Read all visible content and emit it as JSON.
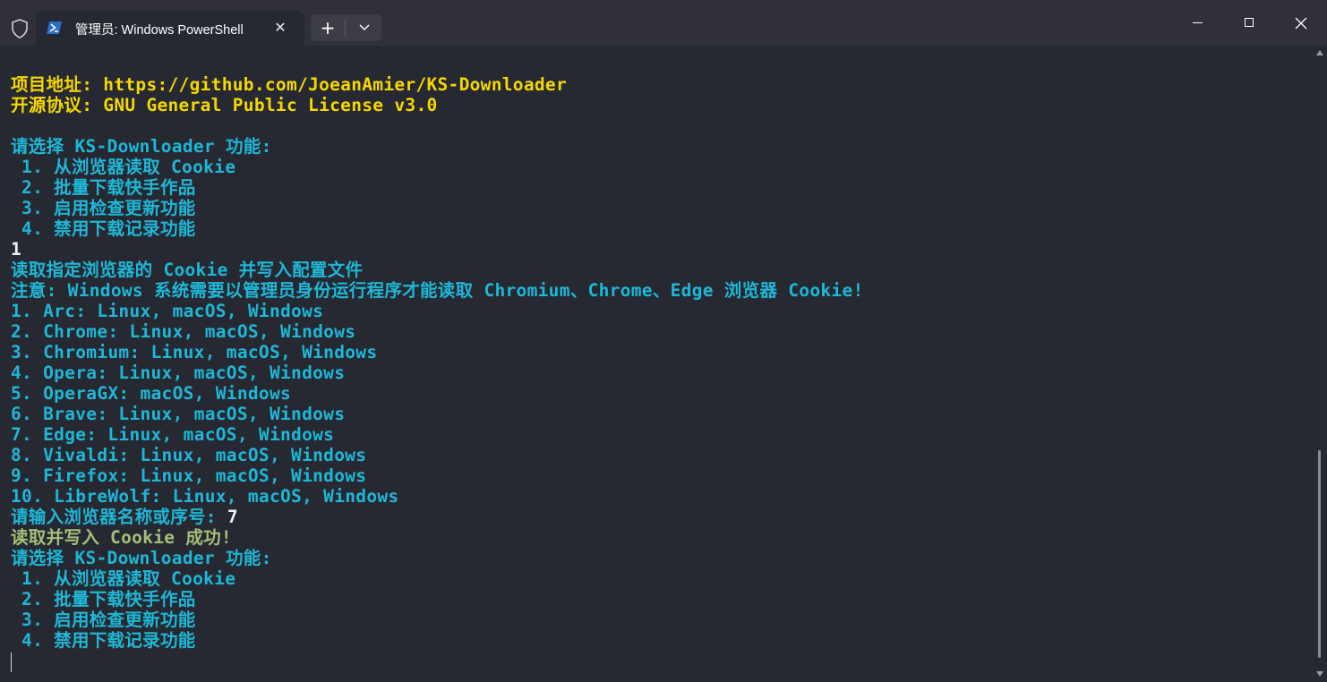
{
  "window": {
    "tab_title": "管理员: Windows PowerShell",
    "tab_close": "✕",
    "new_tab": "+",
    "dropdown": "⌄",
    "icons": {
      "shield": "shield-icon",
      "powershell": "powershell-icon",
      "minimize": "minimize-icon",
      "maximize": "maximize-icon",
      "close": "close-icon"
    }
  },
  "terminal": {
    "lines": [
      {
        "text": "项目地址: https://github.com/JoeanAmier/KS-Downloader",
        "color": "yellow"
      },
      {
        "text": "开源协议: GNU General Public License v3.0",
        "color": "yellow"
      },
      {
        "text": "",
        "color": "cyan"
      },
      {
        "text": "请选择 KS-Downloader 功能:",
        "color": "cyan"
      },
      {
        "text": " 1. 从浏览器读取 Cookie",
        "color": "cyan"
      },
      {
        "text": " 2. 批量下载快手作品",
        "color": "cyan"
      },
      {
        "text": " 3. 启用检查更新功能",
        "color": "cyan"
      },
      {
        "text": " 4. 禁用下载记录功能",
        "color": "cyan"
      },
      {
        "text": "1",
        "color": "white"
      },
      {
        "text": "读取指定浏览器的 Cookie 并写入配置文件",
        "color": "cyan"
      },
      {
        "text": "注意: Windows 系统需要以管理员身份运行程序才能读取 Chromium、Chrome、Edge 浏览器 Cookie!",
        "color": "cyan"
      },
      {
        "text": "1. Arc: Linux, macOS, Windows",
        "color": "cyan"
      },
      {
        "text": "2. Chrome: Linux, macOS, Windows",
        "color": "cyan"
      },
      {
        "text": "3. Chromium: Linux, macOS, Windows",
        "color": "cyan"
      },
      {
        "text": "4. Opera: Linux, macOS, Windows",
        "color": "cyan"
      },
      {
        "text": "5. OperaGX: macOS, Windows",
        "color": "cyan"
      },
      {
        "text": "6. Brave: Linux, macOS, Windows",
        "color": "cyan"
      },
      {
        "text": "7. Edge: Linux, macOS, Windows",
        "color": "cyan"
      },
      {
        "text": "8. Vivaldi: Linux, macOS, Windows",
        "color": "cyan"
      },
      {
        "text": "9. Firefox: Linux, macOS, Windows",
        "color": "cyan"
      },
      {
        "text": "10. LibreWolf: Linux, macOS, Windows",
        "color": "cyan"
      },
      {
        "text": "请输入浏览器名称或序号: ",
        "color": "cyan",
        "input": "7"
      },
      {
        "text": "读取并写入 Cookie 成功!",
        "color": "green"
      },
      {
        "text": "请选择 KS-Downloader 功能:",
        "color": "cyan"
      },
      {
        "text": " 1. 从浏览器读取 Cookie",
        "color": "cyan"
      },
      {
        "text": " 2. 批量下载快手作品",
        "color": "cyan"
      },
      {
        "text": " 3. 启用检查更新功能",
        "color": "cyan"
      },
      {
        "text": " 4. 禁用下载记录功能",
        "color": "cyan"
      }
    ]
  },
  "colors": {
    "yellow": "#f5d800",
    "cyan": "#1fb7d6",
    "white": "#f0f0f0",
    "green": "#a3c07a",
    "background": "#262832",
    "titlebar": "#2f3038"
  }
}
